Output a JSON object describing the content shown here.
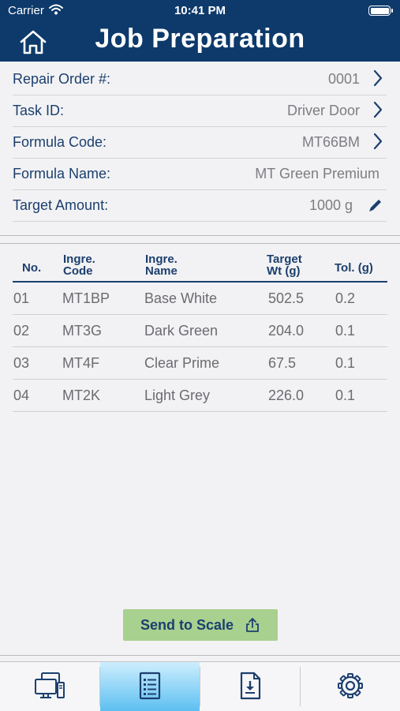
{
  "status_bar": {
    "carrier": "Carrier",
    "time": "10:41 PM"
  },
  "header": {
    "title": "Job Preparation",
    "home_icon": "home-icon"
  },
  "form": {
    "repair_order": {
      "label": "Repair Order #:",
      "value": "0001"
    },
    "task_id": {
      "label": "Task ID:",
      "value": "Driver Door"
    },
    "formula_code": {
      "label": "Formula Code:",
      "value": "MT66BM"
    },
    "formula_name": {
      "label": "Formula Name:",
      "value": "MT Green Premium"
    },
    "target_amount": {
      "label": "Target Amount:",
      "value": "1000 g"
    }
  },
  "table": {
    "headers": {
      "no": "No.",
      "code_1": "Ingre.",
      "code_2": "Code",
      "name_1": "Ingre.",
      "name_2": "Name",
      "target_1": "Target",
      "target_2": "Wt (g)",
      "tol": "Tol. (g)"
    },
    "rows": [
      {
        "no": "01",
        "code": "MT1BP",
        "name": "Base White",
        "target": "502.5",
        "tol": "0.2"
      },
      {
        "no": "02",
        "code": "MT3G",
        "name": "Dark Green",
        "target": "204.0",
        "tol": "0.1"
      },
      {
        "no": "03",
        "code": "MT4F",
        "name": "Clear Prime",
        "target": "67.5",
        "tol": "0.1"
      },
      {
        "no": "04",
        "code": "MT2K",
        "name": "Light Grey",
        "target": "226.0",
        "tol": "0.1"
      }
    ]
  },
  "actions": {
    "send_label": "Send to Scale",
    "send_icon": "share-icon"
  },
  "tabs": [
    {
      "icon": "devices-icon",
      "active": false
    },
    {
      "icon": "document-list-icon",
      "active": true
    },
    {
      "icon": "document-download-icon",
      "active": false
    },
    {
      "icon": "gear-icon",
      "active": false
    }
  ],
  "colors": {
    "primary": "#0d3a6b",
    "label": "#1c3f6e",
    "button": "#a8d08f",
    "active_tab": "#5dbff1"
  }
}
